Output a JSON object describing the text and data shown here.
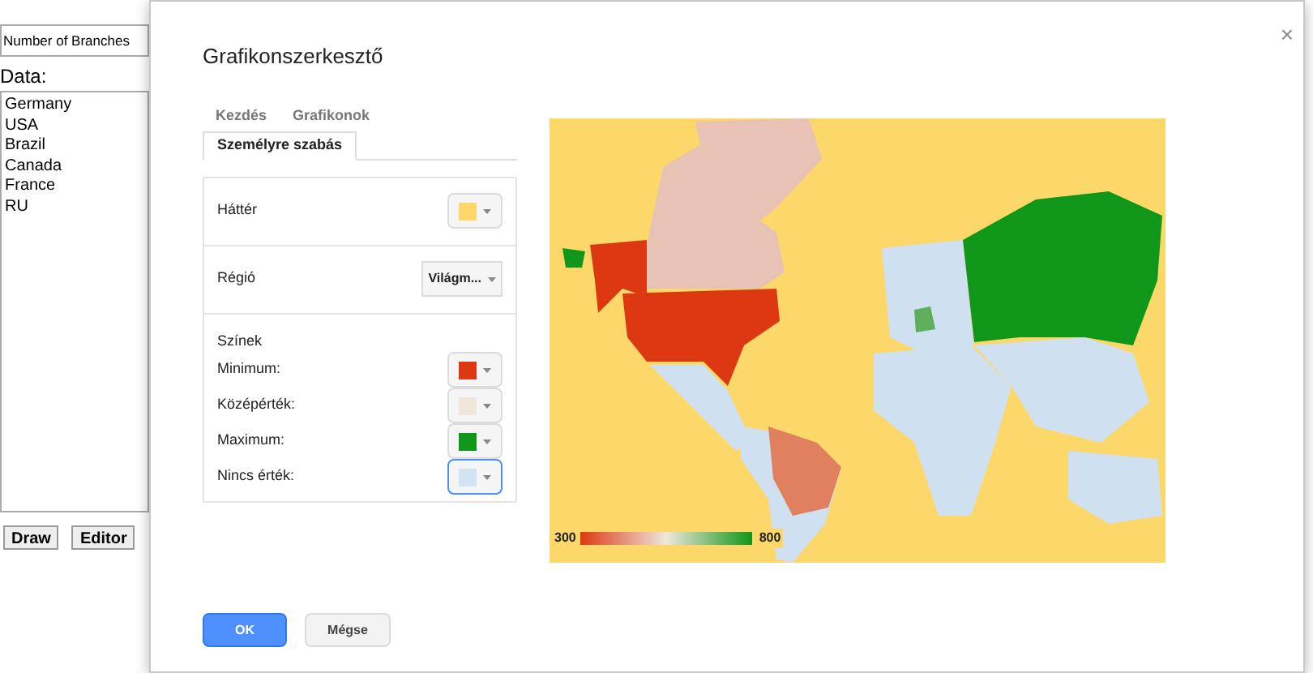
{
  "background_page": {
    "title_field": "Number of Branches",
    "data_label": "Data:",
    "data_rows": [
      "Germany",
      "USA",
      "Brazil",
      "Canada",
      "France",
      "RU"
    ],
    "buttons": [
      "Draw",
      "Editor"
    ]
  },
  "dialog": {
    "title": "Grafikonszerkesztő",
    "close": "×",
    "tabs": [
      {
        "label": "Kezdés",
        "selected": false
      },
      {
        "label": "Grafikonok",
        "selected": false
      },
      {
        "label": "Személyre szabás",
        "selected": true
      }
    ],
    "sections": [
      {
        "kind": "color",
        "label": "Háttér",
        "color": "#fcd86a"
      },
      {
        "kind": "select",
        "label": "Régió",
        "value": "Világm..."
      },
      {
        "kind": "colors",
        "heading": "Színek",
        "items": [
          {
            "label": "Minimum:",
            "color": "#dc3912",
            "focused": false
          },
          {
            "label": "Középérték:",
            "color": "#efe6dc",
            "focused": false
          },
          {
            "label": "Maximum:",
            "color": "#109618",
            "focused": false
          },
          {
            "label": "Nincs érték:",
            "color": "#d2e3f3",
            "focused": true
          }
        ]
      }
    ],
    "map": {
      "legend_min": "300",
      "legend_max": "800"
    },
    "buttons": [
      {
        "label": "OK",
        "kind": "primary"
      },
      {
        "label": "Mégse",
        "kind": "secondary"
      }
    ]
  }
}
